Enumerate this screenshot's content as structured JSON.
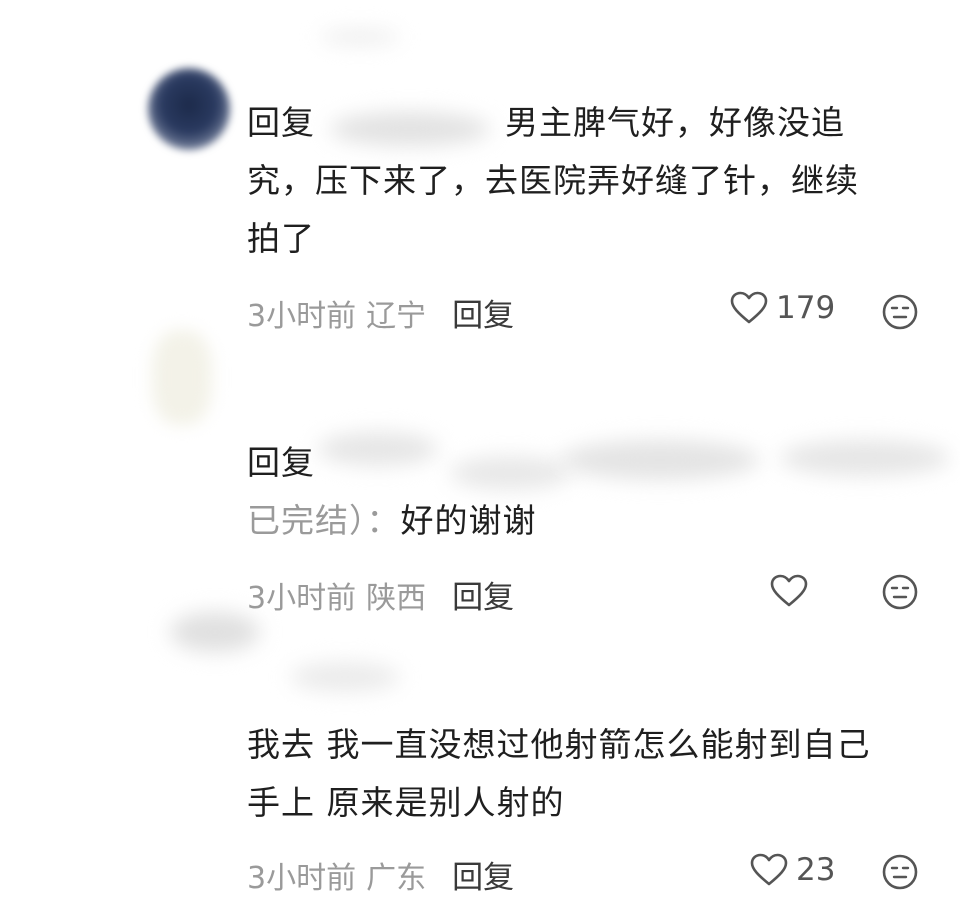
{
  "comments": [
    {
      "line1_prefix": "回复",
      "line1_rest": "男主脾气好，好像没追",
      "line2": "究，压下来了，去医院弄好缝了针，继续",
      "line3": "拍了",
      "time": "3小时前",
      "location": "辽宁",
      "reply_label": "回复",
      "likes": "179"
    },
    {
      "line1_prefix": "回复",
      "line2_muted": "已完结）：",
      "line2_text": "好的谢谢",
      "time": "3小时前",
      "location": "陕西",
      "reply_label": "回复",
      "likes": ""
    },
    {
      "line1": "我去 我一直没想过他射箭怎么能射到自己",
      "line2": "手上 原来是别人射的",
      "time": "3小时前",
      "location": "广东",
      "reply_label": "回复",
      "likes": "23"
    }
  ],
  "colors": {
    "text": "#1f1f1f",
    "muted": "#9a9a9a",
    "icon": "#555555"
  },
  "icons": [
    "heart-icon",
    "dislike-face-icon"
  ]
}
